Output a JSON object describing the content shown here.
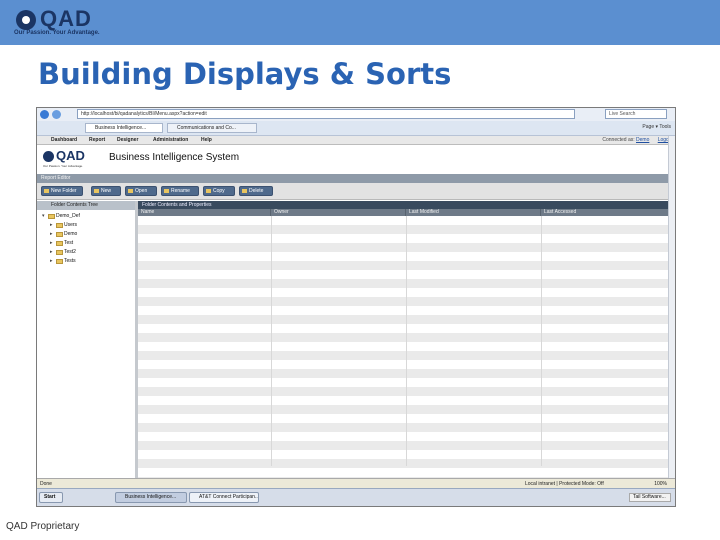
{
  "banner": {
    "logo_text": "QAD",
    "tagline": "Our Passion. Your Advantage."
  },
  "slide": {
    "title": "Building Displays & Sorts",
    "footer": "QAD Proprietary"
  },
  "browser": {
    "address": "http://localhost/bi/qadanalytics/BI/Menu.aspx?action=edit",
    "search_placeholder": "Live Search",
    "tabs": [
      "Business Intelligence...",
      "Communications and Co..."
    ],
    "tools": [
      "Page",
      "Tools"
    ]
  },
  "app": {
    "menu": [
      "Dashboard",
      "Report",
      "Designer",
      "Administration",
      "Help"
    ],
    "connected_label": "Connected as:",
    "connected_user": "Demo",
    "logout": "Logout",
    "logo_text": "QAD",
    "logo_tagline": "Our Passion. Your Advantage.",
    "title": "Business Intelligence System",
    "breadcrumb": "Report Editor",
    "toolbar": [
      "New Folder",
      "New",
      "Open",
      "Rename",
      "Copy",
      "Delete"
    ],
    "folder_tree_header": "Folder Contents Tree",
    "tree": [
      {
        "label": "Demo_Def",
        "level": 0,
        "expanded": true
      },
      {
        "label": "Users",
        "level": 1
      },
      {
        "label": "Demo",
        "level": 1
      },
      {
        "label": "Test",
        "level": 1
      },
      {
        "label": "Test2",
        "level": 1
      },
      {
        "label": "Tests",
        "level": 1
      }
    ],
    "contents_header": "Folder Contents and Properties",
    "columns": [
      "Name",
      "Owner",
      "Last Modified",
      "Last Accessed"
    ]
  },
  "status": {
    "left": "Done",
    "zone": "Local intranet | Protected Mode: Off",
    "zoom": "100%"
  },
  "taskbar": {
    "start": "Start",
    "tasks": [
      "Business Intelligence...",
      "AT&T Connect Participan..."
    ],
    "clock": "Tail Software..."
  }
}
